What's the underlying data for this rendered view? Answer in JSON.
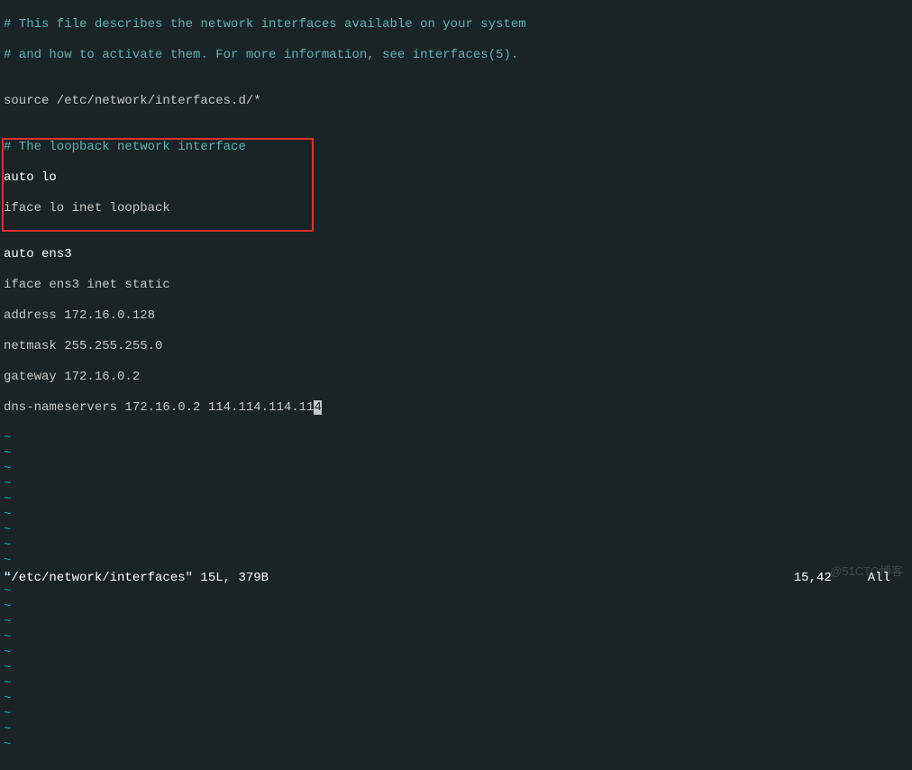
{
  "content": {
    "comment1": "# This file describes the network interfaces available on your system",
    "comment2": "# and how to activate them. For more information, see interfaces(5).",
    "blank1": "",
    "source_line": "source /etc/network/interfaces.d/*",
    "blank2": "",
    "comment3": "# The loopback network interface",
    "auto_lo": "auto lo",
    "iface_lo": "iface lo inet loopback",
    "blank3": "",
    "highlighted": [
      "auto ens3",
      "iface ens3 inet static",
      "address 172.16.0.128",
      "netmask 255.255.255.0",
      "gateway 172.16.0.2",
      "dns-nameservers 172.16.0.2 114.114.114.11"
    ],
    "cursor_char": "4"
  },
  "tilde": "~",
  "tilde_count": 21,
  "status": {
    "filename": "\"/etc/network/interfaces\" 15L, 379B",
    "position": "15,42",
    "percent": "All"
  },
  "watermark": "@51CTO博客"
}
